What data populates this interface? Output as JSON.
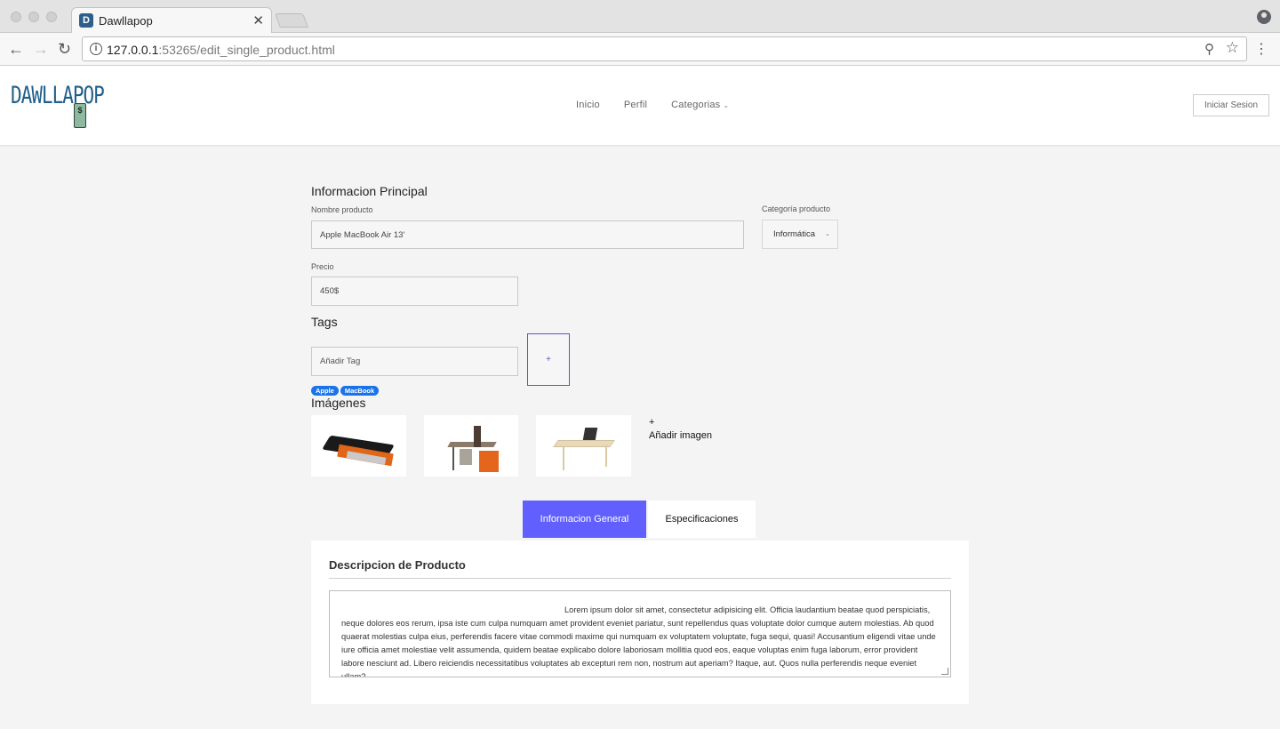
{
  "browser": {
    "tab_title": "Dawllapop",
    "tab_favicon_letter": "D",
    "url_host": "127.0.0.1",
    "url_rest": ":53265/edit_single_product.html"
  },
  "header": {
    "logo_text": "DAWLLAPOP",
    "logo_tag_symbol": "$",
    "nav": [
      {
        "label": "Inicio"
      },
      {
        "label": "Perfil"
      },
      {
        "label": "Categorias"
      }
    ],
    "login_label": "Iniciar Sesion"
  },
  "form": {
    "main_title": "Informacion Principal",
    "name_label": "Nombre producto",
    "name_value": "Apple MacBook Air 13'",
    "category_label": "Categoría producto",
    "category_value": "Informática",
    "price_label": "Precio",
    "price_value": "450$",
    "tags_title": "Tags",
    "tag_placeholder": "Añadir Tag",
    "add_tag_symbol": "+",
    "tags": [
      "Apple",
      "MacBook"
    ],
    "images_title": "Imágenes",
    "add_image_symbol": "+",
    "add_image_label": "Añadir imagen"
  },
  "tabs": {
    "general": "Informacion General",
    "specs": "Especificaciones"
  },
  "description": {
    "title": "Descripcion de Producto",
    "text": "Lorem ipsum dolor sit amet, consectetur adipisicing elit. Officia laudantium beatae quod perspiciatis, neque dolores eos rerum, ipsa iste cum culpa numquam amet provident eveniet pariatur, sunt repellendus quas voluptate dolor cumque autem molestias. Ab quod quaerat molestias culpa eius, perferendis facere vitae commodi maxime qui numquam ex voluptatem voluptate, fuga sequi, quasi! Accusantium eligendi vitae unde iure officia amet molestiae velit assumenda, quidem beatae explicabo dolore laboriosam mollitia quod eos, eaque voluptas enim fuga laborum, error provident labore nesciunt ad. Libero reiciendis necessitatibus voluptates ab excepturi rem non, nostrum aut aperiam? Itaque, aut. Quos nulla perferendis neque eveniet ullam?"
  },
  "colors": {
    "accent": "#6160fe",
    "tag_blue": "#1a73e8",
    "logo_blue": "#1f5f8b"
  }
}
